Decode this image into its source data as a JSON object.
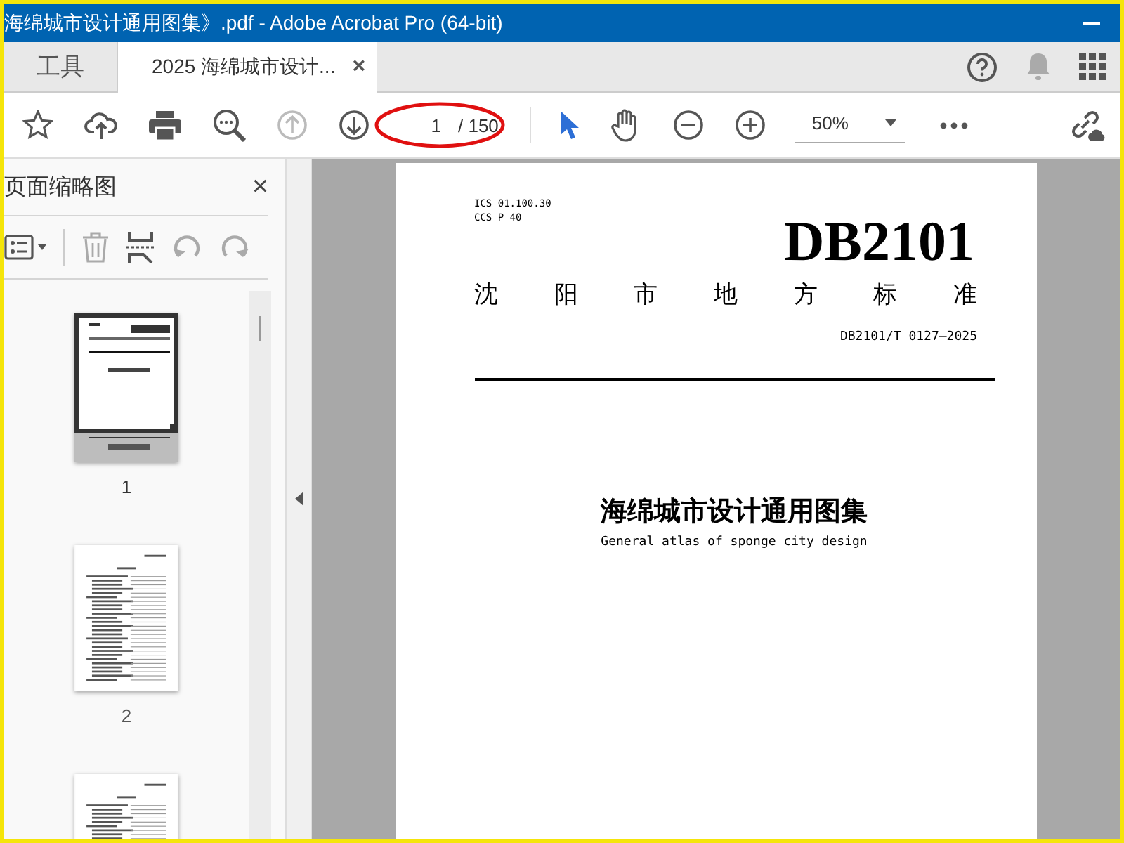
{
  "window": {
    "title": "海绵城市设计通用图集》.pdf - Adobe Acrobat Pro (64-bit)"
  },
  "tabs": [
    {
      "label": "工具",
      "selected": false
    },
    {
      "label": "2025 海绵城市设计...",
      "selected": true,
      "close": "×"
    }
  ],
  "toolbar": {
    "nav": [
      {
        "kind": "up",
        "disabled": true
      },
      {
        "kind": "down",
        "disabled": false
      }
    ],
    "page_value": "1",
    "page_total": "/ 150",
    "page_circled": true,
    "tools": [
      {
        "kind": "pointer",
        "selected": true
      },
      {
        "kind": "hand",
        "selected": false
      }
    ],
    "zoom": "50%"
  },
  "sidebar": {
    "title": "页面缩略图",
    "close": "×",
    "thumbnails": [
      {
        "kind": "cover",
        "label": "1",
        "selected": true
      },
      {
        "kind": "toc",
        "label": "2",
        "selected": false
      },
      {
        "kind": "toc",
        "selected": false
      }
    ]
  },
  "document": {
    "ics": "ICS 01.100.30",
    "ccs": "CCS P 40",
    "code": "DB2101",
    "authority": "沈阳市地方标准",
    "number": "DB2101/T 0127—2025",
    "title": "海绵城市设计通用图集",
    "subtitle": "General atlas of sponge city design"
  }
}
